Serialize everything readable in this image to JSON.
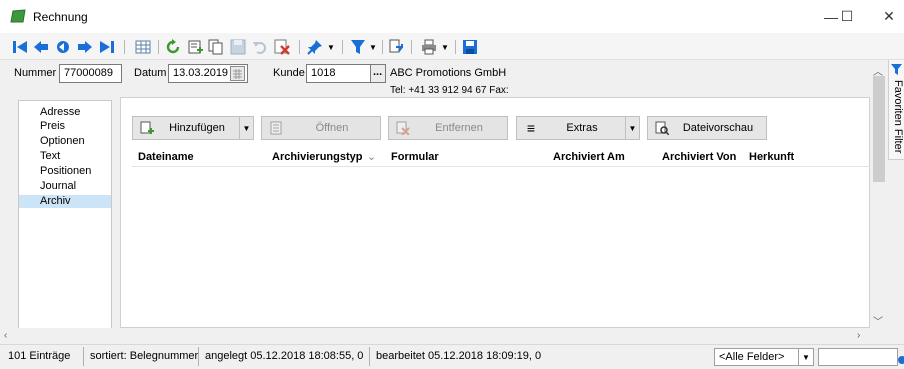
{
  "window": {
    "title": "Rechnung",
    "minimize_glyph": "—",
    "maximize_glyph": "☐",
    "close_glyph": "✕"
  },
  "toolbar": {
    "icons": [
      "first-record-icon",
      "previous-record-icon",
      "back-icon",
      "next-record-icon",
      "last-record-icon",
      "table-view-icon",
      "refresh-icon",
      "new-record-icon",
      "copy-record-icon",
      "save-icon",
      "undo-icon",
      "delete-icon",
      "pin-icon",
      "filter-icon",
      "export-icon",
      "print-icon",
      "disk-icon"
    ]
  },
  "header": {
    "nummer_label": "Nummer",
    "nummer_value": "77000089",
    "datum_label": "Datum",
    "datum_value": "13.03.2019",
    "kunde_label": "Kunde",
    "kunde_value": "1018",
    "lookup_label": "...",
    "customer_name": "ABC Promotions GmbH",
    "customer_contact": "Tel: +41 33 912 94 67   Fax:"
  },
  "nav": {
    "items": [
      {
        "label": "Adresse",
        "selected": false
      },
      {
        "label": "Preis",
        "selected": false
      },
      {
        "label": "Optionen",
        "selected": false
      },
      {
        "label": "Text",
        "selected": false
      },
      {
        "label": "Positionen",
        "selected": false
      },
      {
        "label": "Journal",
        "selected": false
      },
      {
        "label": "Archiv",
        "selected": true
      }
    ]
  },
  "actions": {
    "add": "Hinzufügen",
    "open": "Öffnen",
    "remove": "Entfernen",
    "extras": "Extras",
    "preview": "Dateivorschau"
  },
  "table": {
    "columns": [
      "Dateiname",
      "Archivierungstyp",
      "Formular",
      "Archiviert Am",
      "Archiviert Von",
      "Herkunft"
    ],
    "sort_glyph": "⌄",
    "rows": []
  },
  "favorites": {
    "label": "Favoriten Filter"
  },
  "status": {
    "count": "101 Einträge",
    "sorted": "sortiert: Belegnummer",
    "created": "angelegt 05.12.2018 18:08:55,  0",
    "edited": "bearbeitet 05.12.2018 18:09:19,  0",
    "field_filter": "<Alle Felder>"
  },
  "colors": {
    "accent_blue": "#1a6ed8",
    "selection": "#cce4f7",
    "green": "#3a9b2c",
    "red": "#d03a2b"
  }
}
